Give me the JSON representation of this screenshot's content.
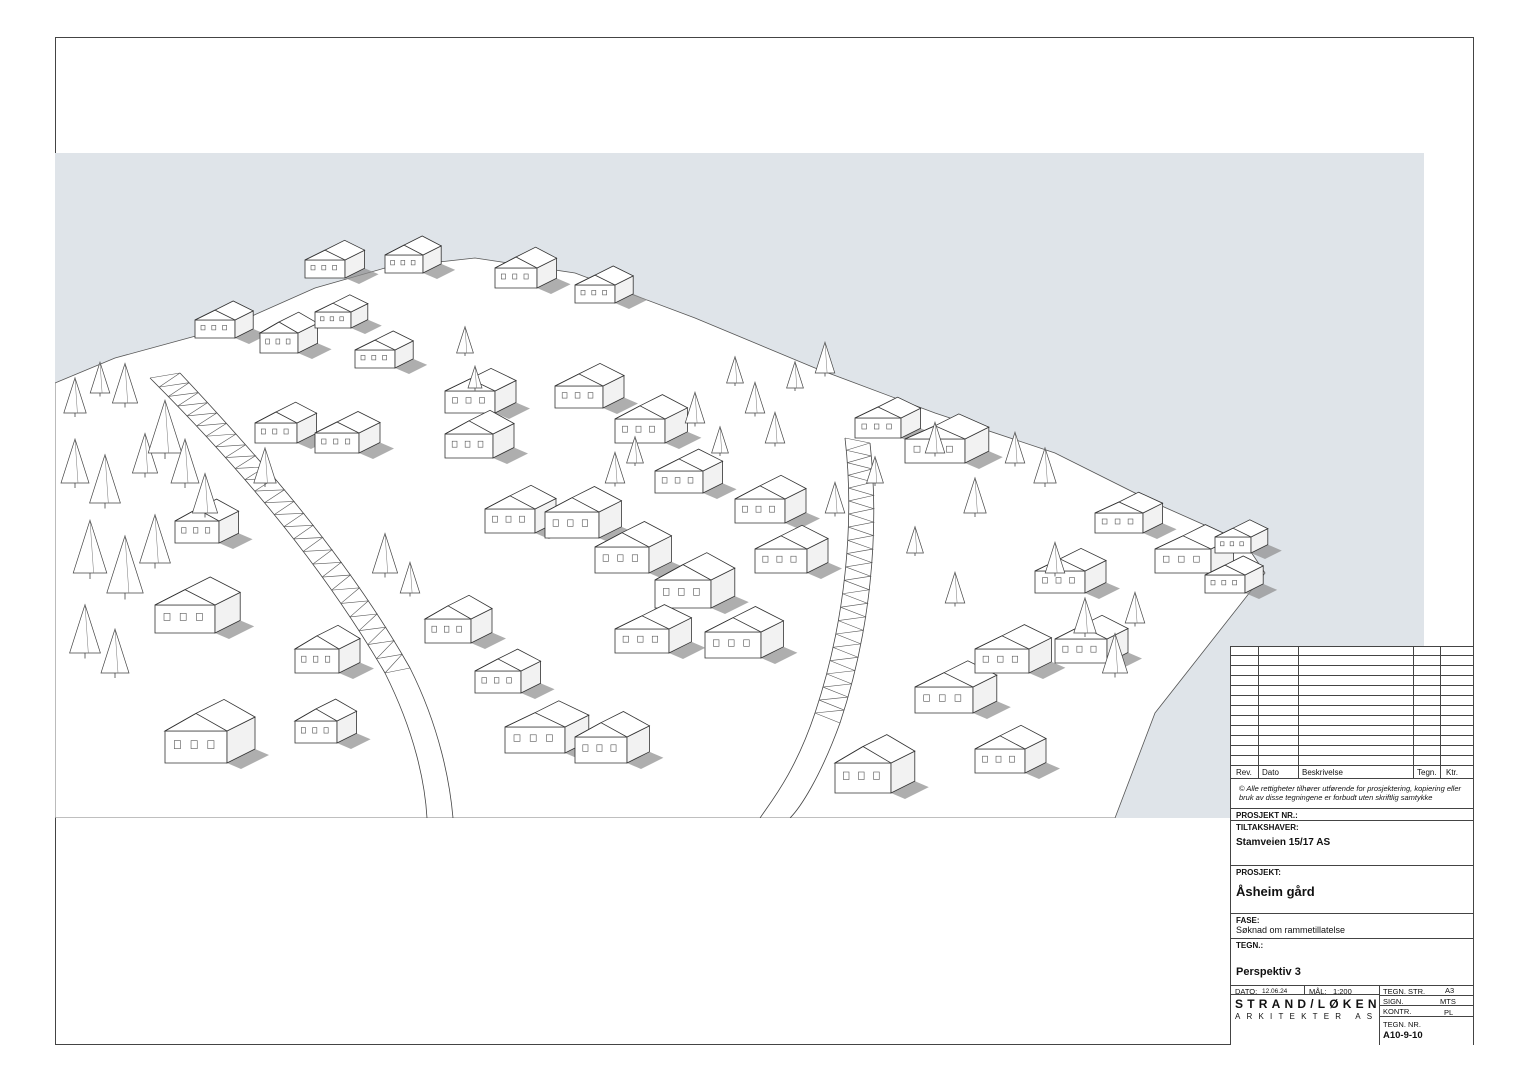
{
  "revision_table": {
    "headers": [
      "Rev.",
      "Dato",
      "Beskrivelse",
      "Tegn.",
      "Ktr."
    ]
  },
  "copyright": "© Alle rettigheter tilhører utførende for prosjektering, kopiering eller bruk av disse tegningene er forbudt uten skriftlig samtykke",
  "project_number": {
    "label": "PROSJEKT NR.:",
    "value": ""
  },
  "client": {
    "label": "TILTAKSHAVER:",
    "value": "Stamveien 15/17 AS"
  },
  "project": {
    "label": "PROSJEKT:",
    "value": "Åsheim gård"
  },
  "phase": {
    "label": "FASE:",
    "value": "Søknad om rammetillatelse"
  },
  "drawing": {
    "label": "TEGN.:",
    "value": "Perspektiv 3"
  },
  "date": {
    "label": "DATO:",
    "value": "12.06.24"
  },
  "scale": {
    "label": "MÅL:",
    "value": "1:200"
  },
  "sheet_size": {
    "label": "TEGN. STR.",
    "value": "A3"
  },
  "signed": {
    "label": "SIGN.",
    "value": "MTS"
  },
  "checked": {
    "label": "KONTR.",
    "value": "PL"
  },
  "drawing_number": {
    "label": "TEGN. NR.",
    "value": "A10-9-10"
  },
  "logo": {
    "line1": "STRAND/LØKEN",
    "line2": "ARKITEKTER AS"
  },
  "colors": {
    "sky": "#dfe4e9",
    "line": "#444444",
    "shadow": "#8c8c8c"
  }
}
